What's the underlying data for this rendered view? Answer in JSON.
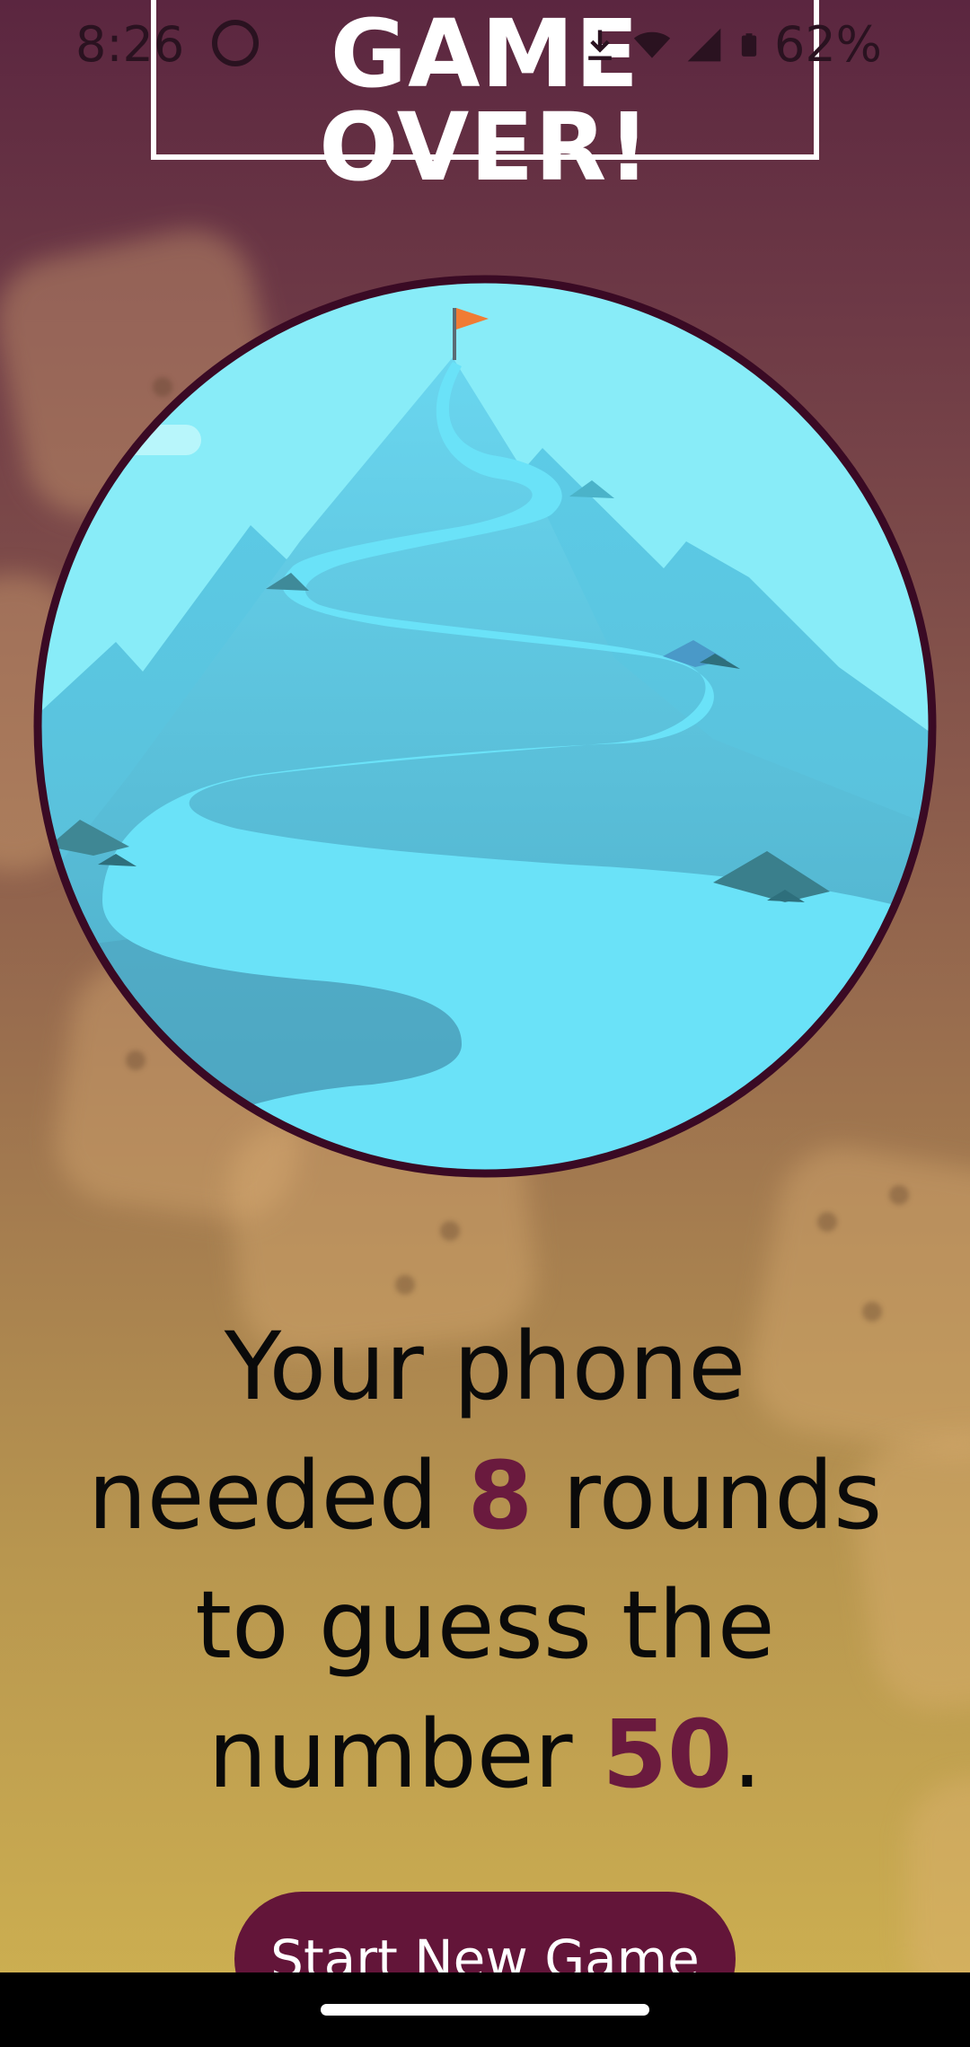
{
  "status_bar": {
    "time": "8:26",
    "battery": "62%",
    "icons": [
      "google-g-icon",
      "download-icon",
      "wifi-icon",
      "signal-icon",
      "battery-icon"
    ]
  },
  "title": "GAME OVER!",
  "illustration": {
    "icon": "mountain-summit-flag-illustration"
  },
  "result": {
    "line1": "Your phone",
    "line2_before": "needed ",
    "rounds": "8",
    "line2_after": " rounds",
    "line3": "to guess the",
    "line4_before": "number ",
    "number": "50",
    "line4_after": "."
  },
  "start_button": {
    "label": "Start New Game"
  },
  "colors": {
    "accent": "#631539",
    "highlight_text": "#6a1a3e",
    "title_text": "#ffffff",
    "circle_border": "#3a0a24",
    "sky": "#88ecf8",
    "river": "#6ae2f8"
  }
}
